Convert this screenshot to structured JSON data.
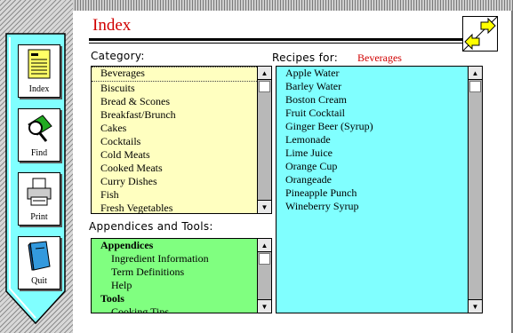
{
  "toolbar": {
    "index_label": "Index",
    "find_label": "Find",
    "print_label": "Print",
    "quit_label": "Quit"
  },
  "page": {
    "title": "Index"
  },
  "category": {
    "label": "Category:",
    "items": [
      "Beverages",
      "Biscuits",
      "Bread & Scones",
      "Breakfast/Brunch",
      "Cakes",
      "Cocktails",
      "Cold Meats",
      "Cooked Meats",
      "Curry Dishes",
      "Fish",
      "Fresh Vegetables"
    ],
    "selected": "Beverages"
  },
  "appendices": {
    "label": "Appendices and Tools:",
    "items": [
      {
        "text": "Appendices",
        "kind": "head"
      },
      {
        "text": "Ingredient Information",
        "kind": "sub"
      },
      {
        "text": "Term Definitions",
        "kind": "sub"
      },
      {
        "text": "Help",
        "kind": "sub"
      },
      {
        "text": "Tools",
        "kind": "head"
      },
      {
        "text": "Cooking Tips",
        "kind": "sub"
      }
    ]
  },
  "recipes": {
    "label": "Recipes for:",
    "category": "Beverages",
    "items": [
      "Apple Water",
      "Barley Water",
      "Boston Cream",
      "Fruit Cocktail",
      "Ginger Beer (Syrup)",
      "Lemonade",
      "Lime Juice",
      "Orange Cup",
      "Orangeade",
      "Pineapple Punch",
      "Wineberry Syrup"
    ]
  },
  "colors": {
    "category_bg": "#ffffc0",
    "appendices_bg": "#80ff80",
    "recipes_bg": "#80ffff",
    "panel_bg": "#80ffff",
    "title_red": "#d00000"
  }
}
